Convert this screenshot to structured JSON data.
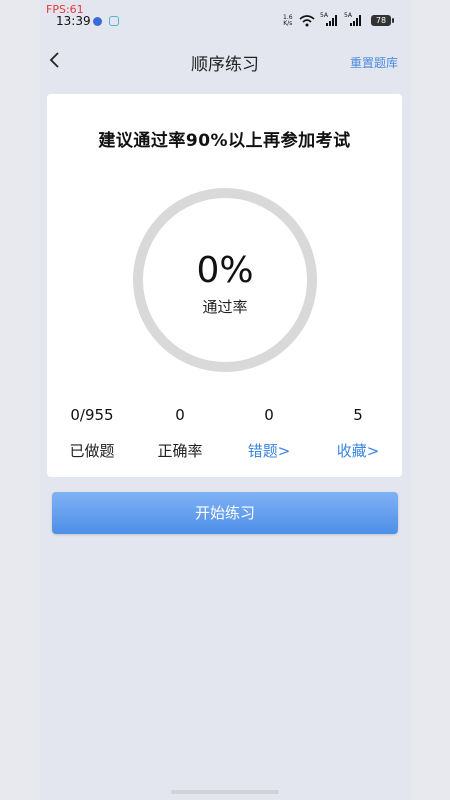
{
  "overlay": {
    "fps": "FPS:61"
  },
  "status_bar": {
    "time": "13:39",
    "net_speed_value": "1.6",
    "net_speed_unit": "K/s",
    "signal_1": "5A",
    "signal_2": "5A",
    "battery": "78"
  },
  "header": {
    "title": "顺序练习",
    "action": "重置题库"
  },
  "card": {
    "advice": "建议通过率90%以上再参加考试",
    "pass_rate_value": "0%",
    "pass_rate_label": "通过率",
    "stats": [
      {
        "value": "0/955",
        "label": "已做题"
      },
      {
        "value": "0",
        "label": "正确率"
      },
      {
        "value": "0",
        "label": "错题>"
      },
      {
        "value": "5",
        "label": "收藏>"
      }
    ]
  },
  "start_button": {
    "label": "开始练习"
  },
  "colors": {
    "accent": "#3b86e0",
    "button": "#5e9cec",
    "background": "#e3e6ee"
  }
}
